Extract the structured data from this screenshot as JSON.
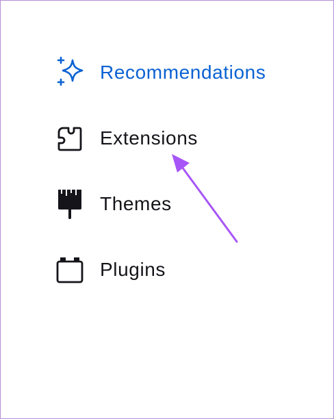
{
  "sidebar": {
    "items": [
      {
        "label": "Recommendations",
        "icon": "sparkle-icon",
        "active": true
      },
      {
        "label": "Extensions",
        "icon": "puzzle-piece-icon",
        "active": false
      },
      {
        "label": "Themes",
        "icon": "paintbrush-icon",
        "active": false
      },
      {
        "label": "Plugins",
        "icon": "plugin-block-icon",
        "active": false
      }
    ]
  },
  "colors": {
    "active_text": "#0a62d3",
    "text": "#15141a",
    "arrow": "#a855f7",
    "border": "#b48fd6",
    "background": "#ffffff"
  },
  "annotation": {
    "icon": "arrow-icon",
    "target": "sidebar-item-extensions"
  }
}
